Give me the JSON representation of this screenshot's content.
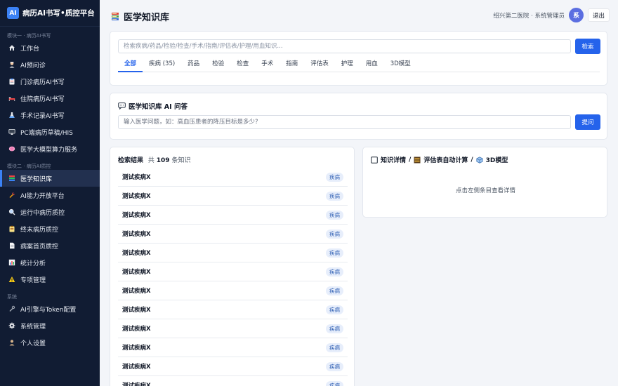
{
  "brand": {
    "logo": "AI",
    "name": "病历AI书写•质控平台"
  },
  "sidebar": {
    "sections": [
      {
        "label": "模块一 · 病历AI书写",
        "items": [
          {
            "label": "工作台",
            "icon": "home-icon"
          },
          {
            "label": "AI预问诊",
            "icon": "doctor-icon"
          },
          {
            "label": "门诊病历AI书写",
            "icon": "clipboard-icon"
          },
          {
            "label": "住院病历AI书写",
            "icon": "bed-icon"
          },
          {
            "label": "手术记录AI书写",
            "icon": "flask-icon"
          },
          {
            "label": "PC端病历草稿/HIS",
            "icon": "monitor-icon"
          },
          {
            "label": "医学大模型算力服务",
            "icon": "brain-icon"
          }
        ]
      },
      {
        "label": "模块二 · 病历AI质控",
        "items": [
          {
            "label": "医学知识库",
            "icon": "books-icon",
            "active": true
          },
          {
            "label": "AI能力开放平台",
            "icon": "plug-icon"
          },
          {
            "label": "运行中病历质控",
            "icon": "search-icon"
          },
          {
            "label": "终末病历质控",
            "icon": "clipboard-check-icon"
          },
          {
            "label": "病案首页质控",
            "icon": "document-icon"
          },
          {
            "label": "统计分析",
            "icon": "chart-icon"
          },
          {
            "label": "专项管理",
            "icon": "warning-icon"
          }
        ]
      },
      {
        "label": "系统",
        "items": [
          {
            "label": "AI引擎与Token配置",
            "icon": "wrench-icon"
          },
          {
            "label": "系统管理",
            "icon": "gear-icon"
          },
          {
            "label": "个人设置",
            "icon": "user-icon"
          }
        ]
      }
    ]
  },
  "header": {
    "title": "医学知识库",
    "org": "绍兴第二医院 · 系统管理员",
    "avatar": "系",
    "logout": "退出"
  },
  "search": {
    "placeholder": "检索疾病/药品/检验/检查/手术/指南/评估表/护理/用血知识...",
    "button": "检索",
    "tabs": [
      "全部",
      "疾病 (35)",
      "药品",
      "检验",
      "检查",
      "手术",
      "指南",
      "评估表",
      "护理",
      "用血",
      "3D模型"
    ],
    "active_tab": 0
  },
  "qa": {
    "title": "医学知识库 AI 问答",
    "placeholder": "输入医学问题，如：高血压患者的降压目标是多少?",
    "button": "提问"
  },
  "results": {
    "title": "检索结果",
    "count_prefix": "共",
    "count": "109",
    "count_suffix": "条知识",
    "items": [
      {
        "name": "测试疾病X",
        "tag": "疾病"
      },
      {
        "name": "测试疾病X",
        "tag": "疾病"
      },
      {
        "name": "测试疾病X",
        "tag": "疾病"
      },
      {
        "name": "测试疾病X",
        "tag": "疾病"
      },
      {
        "name": "测试疾病X",
        "tag": "疾病"
      },
      {
        "name": "测试疾病X",
        "tag": "疾病"
      },
      {
        "name": "测试疾病X",
        "tag": "疾病"
      },
      {
        "name": "测试疾病X",
        "tag": "疾病"
      },
      {
        "name": "测试疾病X",
        "tag": "疾病"
      },
      {
        "name": "测试疾病X",
        "tag": "疾病"
      },
      {
        "name": "测试疾病X",
        "tag": "疾病"
      },
      {
        "name": "测试疾病X",
        "tag": "疾病"
      }
    ]
  },
  "detail": {
    "part1": "知识详情",
    "part2": "评估表自动计算",
    "part3": "3D模型",
    "separator": "/",
    "empty": "点击左侧条目查看详情"
  },
  "colors": {
    "sidebar_bg": "#111c33",
    "accent": "#2563eb",
    "badge_bg": "#e7eefb"
  }
}
